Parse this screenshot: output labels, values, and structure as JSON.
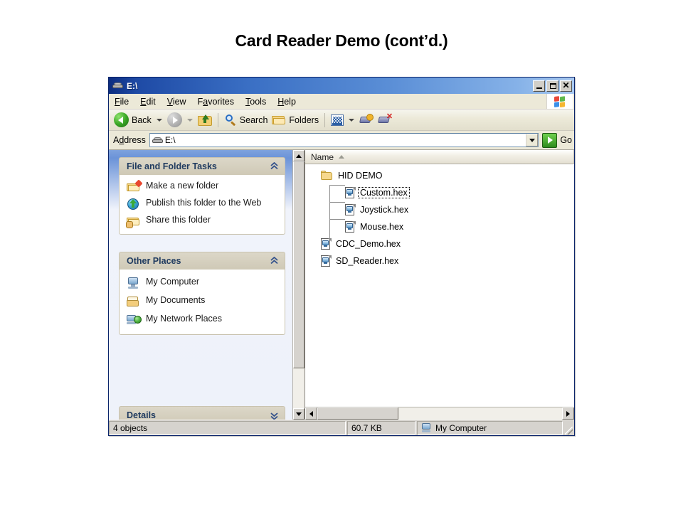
{
  "slide": {
    "title": "Card Reader Demo (cont’d.)"
  },
  "window": {
    "title": "E:\\",
    "title_icon": "drive-icon",
    "buttons": {
      "minimize": "_",
      "maximize": "□",
      "close": "✕"
    }
  },
  "menubar": {
    "items": [
      {
        "label": "File",
        "accel": "F"
      },
      {
        "label": "Edit",
        "accel": "E"
      },
      {
        "label": "View",
        "accel": "V"
      },
      {
        "label": "Favorites",
        "accel": "a"
      },
      {
        "label": "Tools",
        "accel": "T"
      },
      {
        "label": "Help",
        "accel": "H"
      }
    ],
    "brand_icon": "windows-flag-icon"
  },
  "toolbar": {
    "back_label": "Back",
    "forward_label": "",
    "up_label": "",
    "search_label": "Search",
    "folders_label": "Folders",
    "views_label": "",
    "map_drive_label": "",
    "disconnect_drive_label": ""
  },
  "addressbar": {
    "label": "Address",
    "accel": "d",
    "value": "E:\\",
    "placeholder": "E:\\",
    "go_label": "Go",
    "drive_icon": "drive-icon",
    "dropdown_icon": "chevron-down-icon"
  },
  "taskpane": {
    "groups": [
      {
        "title": "File and Folder Tasks",
        "collapse_icon": "double-chevron-up-icon",
        "items": [
          {
            "label": "Make a new folder",
            "icon": "new-folder-icon"
          },
          {
            "label": "Publish this folder to the Web",
            "icon": "publish-web-icon"
          },
          {
            "label": "Share this folder",
            "icon": "share-folder-icon"
          }
        ]
      },
      {
        "title": "Other Places",
        "collapse_icon": "double-chevron-up-icon",
        "items": [
          {
            "label": "My Computer",
            "icon": "my-computer-icon"
          },
          {
            "label": "My Documents",
            "icon": "my-documents-icon"
          },
          {
            "label": "My Network Places",
            "icon": "my-network-places-icon"
          }
        ]
      }
    ],
    "details_group": {
      "title": "Details",
      "expand_icon": "double-chevron-down-icon"
    }
  },
  "filelist": {
    "column_header": "Name",
    "sort_direction": "ascending",
    "items": [
      {
        "name": "HID DEMO",
        "type": "folder",
        "indent": 0,
        "focused": false
      },
      {
        "name": "Custom.hex",
        "type": "file",
        "indent": 1,
        "focused": true
      },
      {
        "name": "Joystick.hex",
        "type": "file",
        "indent": 1,
        "focused": false
      },
      {
        "name": "Mouse.hex",
        "type": "file",
        "indent": 1,
        "focused": false
      },
      {
        "name": "CDC_Demo.hex",
        "type": "file",
        "indent": 0,
        "focused": false
      },
      {
        "name": "SD_Reader.hex",
        "type": "file",
        "indent": 0,
        "focused": false
      }
    ]
  },
  "statusbar": {
    "object_count": "4 objects",
    "size": "60.7 KB",
    "location": "My Computer",
    "location_icon": "my-computer-icon"
  },
  "colors": {
    "titlebar_start": "#0c2d80",
    "titlebar_end": "#a9c9f0",
    "window_face": "#d6d3ce",
    "menu_face": "#ece9d8",
    "taskpane_bg": "#eef3fb",
    "group_header": "#cfc9b6",
    "group_title_text": "#1f3a5f",
    "list_bg": "#ffffff",
    "accent_green": "#2e8b1c"
  }
}
